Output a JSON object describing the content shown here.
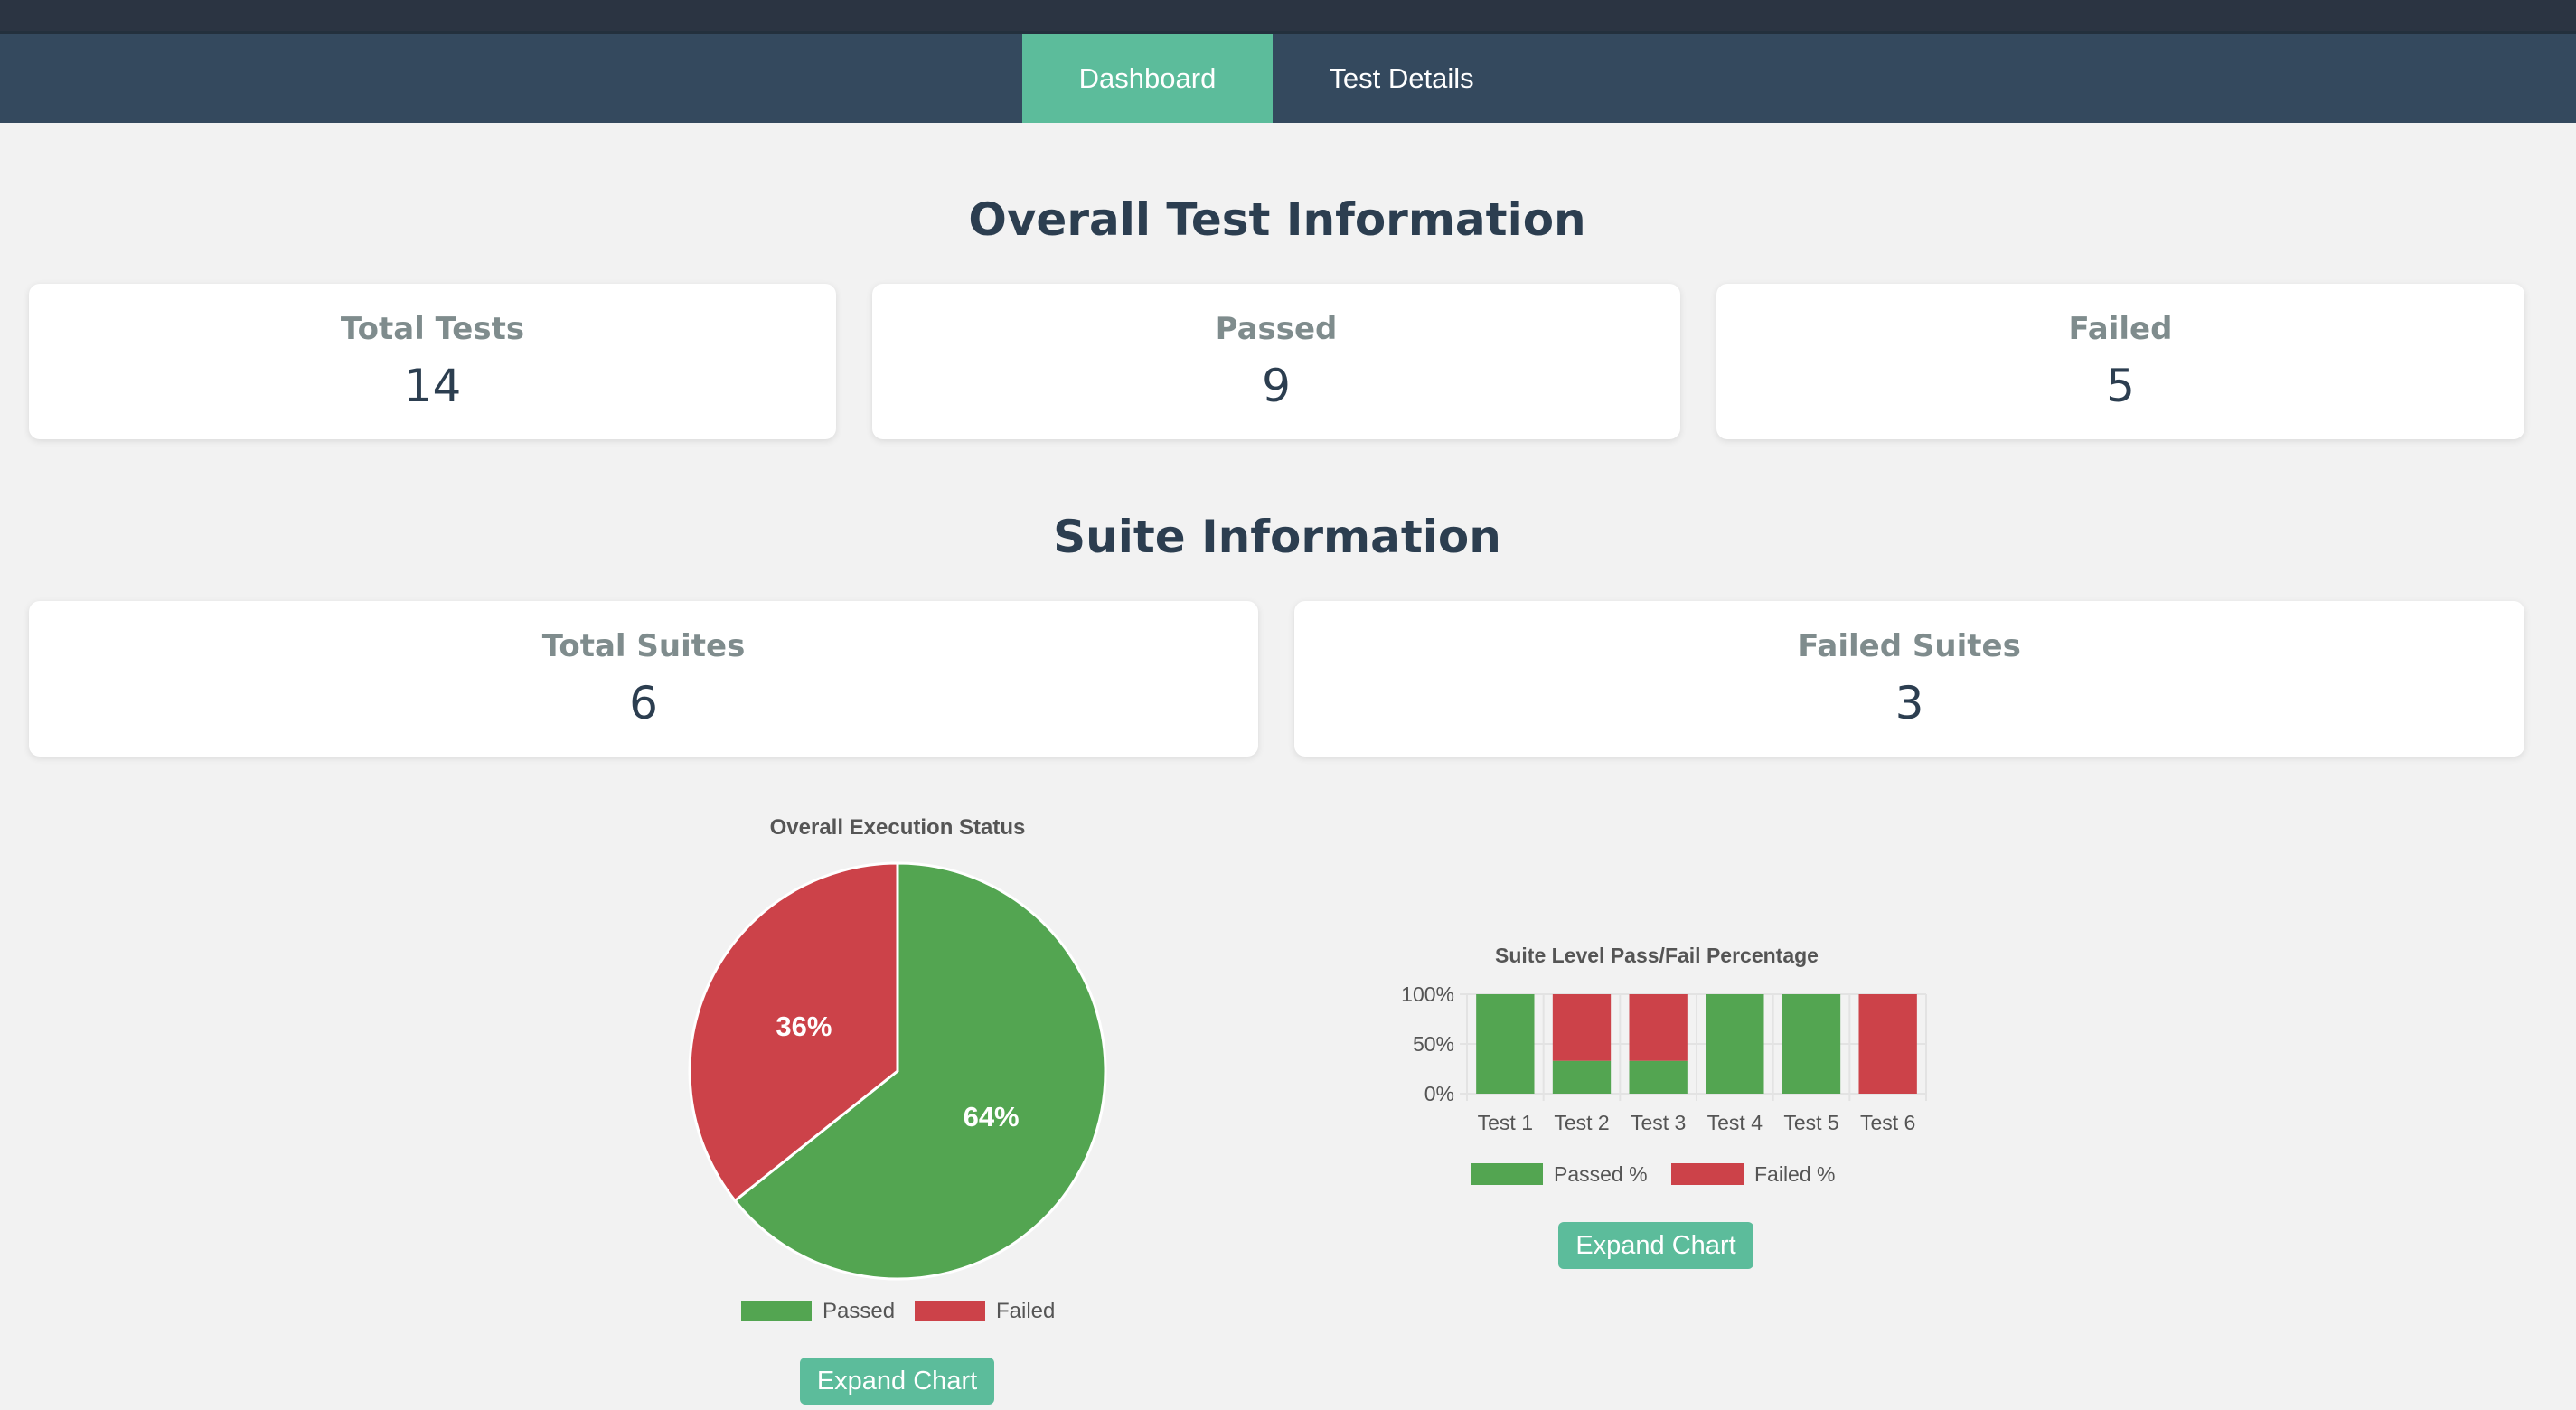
{
  "nav": {
    "tabs": [
      {
        "label": "Dashboard",
        "active": true
      },
      {
        "label": "Test Details",
        "active": false
      }
    ]
  },
  "overall": {
    "title": "Overall Test Information",
    "cards": [
      {
        "label": "Total Tests",
        "value": "14"
      },
      {
        "label": "Passed",
        "value": "9"
      },
      {
        "label": "Failed",
        "value": "5"
      }
    ]
  },
  "suite": {
    "title": "Suite Information",
    "cards": [
      {
        "label": "Total Suites",
        "value": "6"
      },
      {
        "label": "Failed Suites",
        "value": "3"
      }
    ]
  },
  "colors": {
    "passed": "#53a551",
    "failed": "#cc4249",
    "accent": "#5cbc9b",
    "nav": "#34495e"
  },
  "chart_data": [
    {
      "type": "pie",
      "title": "Overall Execution Status",
      "labels": [
        "Passed",
        "Failed"
      ],
      "values": [
        9,
        5
      ],
      "percent_labels": [
        "64%",
        "36%"
      ],
      "legend": "bottom",
      "button_label": "Expand Chart"
    },
    {
      "type": "bar",
      "stacked": true,
      "title": "Suite Level Pass/Fail Percentage",
      "categories": [
        "Test 1",
        "Test 2",
        "Test 3",
        "Test 4",
        "Test 5",
        "Test 6"
      ],
      "series": [
        {
          "name": "Passed %",
          "values": [
            100,
            33,
            33,
            100,
            100,
            0
          ]
        },
        {
          "name": "Failed %",
          "values": [
            0,
            67,
            67,
            0,
            0,
            100
          ]
        }
      ],
      "ylim": [
        0,
        100
      ],
      "yticks": [
        "100%",
        "50%",
        "0%"
      ],
      "grid": true,
      "legend": "bottom",
      "button_label": "Expand Chart"
    }
  ]
}
